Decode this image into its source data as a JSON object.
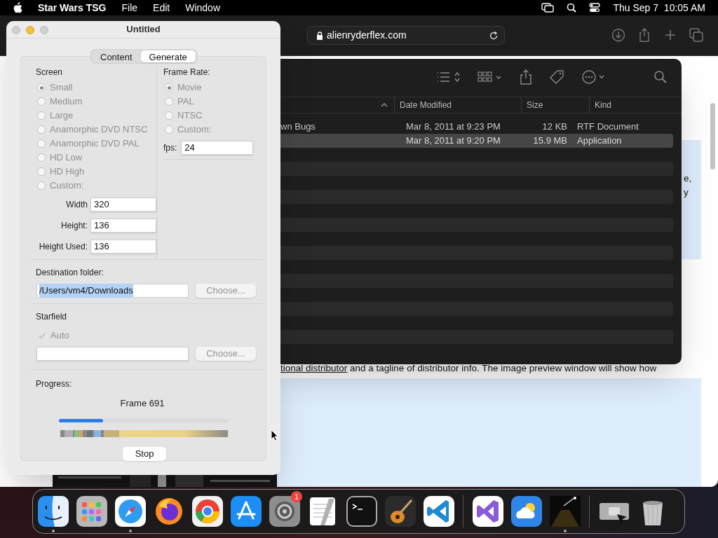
{
  "menu_bar": {
    "app": "Star Wars TSG",
    "menus": [
      "File",
      "Edit",
      "Window"
    ],
    "clock": "Thu Sep 7  10:05 AM"
  },
  "browser": {
    "url": "alienryderflex.com",
    "fragments": [
      "e,",
      "y"
    ],
    "paragraph": {
      "link": "tional distributor",
      "text": " and a tagline of distributor info. The image preview window will show how"
    }
  },
  "finder": {
    "columns": [
      {
        "label": "Date Modified"
      },
      {
        "label": "Size"
      },
      {
        "label": "Kind"
      }
    ],
    "rows": [
      {
        "name": "wn Bugs",
        "date": "Mar 8, 2011 at 9:23 PM",
        "size": "12 KB",
        "kind": "RTF Document",
        "selected": false
      },
      {
        "date": "Mar 8, 2011 at 9:20 PM",
        "size": "15.9 MB",
        "kind": "Application",
        "selected": true
      }
    ]
  },
  "dialog": {
    "title": "Untitled",
    "tabs": [
      {
        "label": "Content",
        "selected": false
      },
      {
        "label": "Generate",
        "selected": true
      }
    ],
    "screen": {
      "label": "Screen",
      "disabled": true,
      "options": [
        {
          "label": "Small",
          "selected": true
        },
        {
          "label": "Medium",
          "selected": false
        },
        {
          "label": "Large",
          "selected": false
        },
        {
          "label": "Anamorphic DVD NTSC",
          "selected": false
        },
        {
          "label": "Anamorphic DVD PAL",
          "selected": false
        },
        {
          "label": "HD Low",
          "selected": false
        },
        {
          "label": "HD High",
          "selected": false
        },
        {
          "label": "Custom:",
          "selected": false
        }
      ],
      "fields": [
        {
          "label": "Width",
          "value": "320"
        },
        {
          "label": "Height:",
          "value": "136"
        },
        {
          "label": "Height Used:",
          "value": "136"
        }
      ]
    },
    "frame_rate": {
      "label": "Frame Rate:",
      "disabled": true,
      "options": [
        {
          "label": "Movie",
          "selected": true
        },
        {
          "label": "PAL",
          "selected": false
        },
        {
          "label": "NTSC",
          "selected": false
        },
        {
          "label": "Custom:",
          "selected": false
        }
      ],
      "fps": {
        "label": "fps:",
        "value": "24"
      }
    },
    "destination": {
      "label": "Destination folder:",
      "value": "/Users/vm4/Downloads",
      "button": "Choose...",
      "button_disabled": true
    },
    "starfield": {
      "label": "Starfield",
      "auto": {
        "label": "Auto",
        "checked": true,
        "disabled": true
      },
      "button": "Choose...",
      "button_disabled": true
    },
    "progress": {
      "label": "Progress:",
      "status": "Frame 691",
      "level": 0.26
    },
    "stop_button": "Stop"
  },
  "dock": {
    "items": [
      {
        "kind": "finder",
        "running": true
      },
      {
        "kind": "launchpad",
        "running": false
      },
      {
        "kind": "safari",
        "running": true
      },
      {
        "kind": "firefox",
        "running": false
      },
      {
        "kind": "chrome",
        "running": false
      },
      {
        "kind": "appstore",
        "running": false
      },
      {
        "kind": "settings",
        "running": false,
        "badge": "1"
      },
      {
        "kind": "textedit",
        "running": false
      },
      {
        "kind": "terminal",
        "running": false
      },
      {
        "kind": "garageband",
        "running": false
      },
      {
        "kind": "vscode",
        "running": false
      },
      {
        "kind": "separator"
      },
      {
        "kind": "visualstudio",
        "running": false
      },
      {
        "kind": "weather",
        "running": false
      },
      {
        "kind": "starwars",
        "running": true
      },
      {
        "kind": "separator"
      },
      {
        "kind": "screenshot",
        "running": false
      },
      {
        "kind": "trash",
        "running": false
      }
    ]
  }
}
